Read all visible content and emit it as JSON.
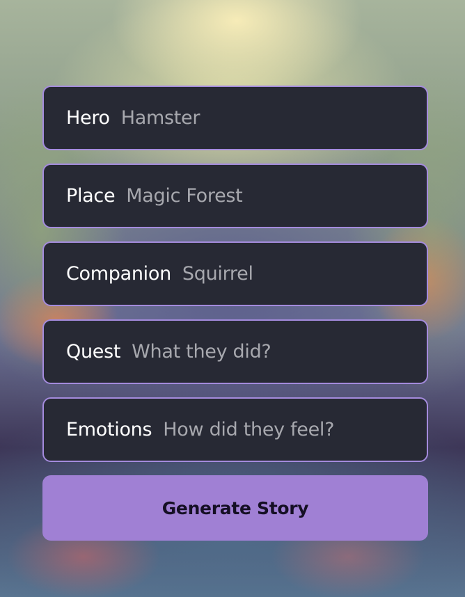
{
  "form": {
    "fields": [
      {
        "label": "Hero",
        "value": "Hamster",
        "placeholder": ""
      },
      {
        "label": "Place",
        "value": "Magic Forest",
        "placeholder": ""
      },
      {
        "label": "Companion",
        "value": "Squirrel",
        "placeholder": ""
      },
      {
        "label": "Quest",
        "value": "",
        "placeholder": "What they did?"
      },
      {
        "label": "Emotions",
        "value": "",
        "placeholder": "How did they feel?"
      }
    ],
    "submit_label": "Generate Story"
  },
  "colors": {
    "field_background": "#272934",
    "field_border": "#a48bdd",
    "button_background": "#a080d4",
    "label_text": "#ffffff",
    "value_text": "#a7a8ae"
  }
}
